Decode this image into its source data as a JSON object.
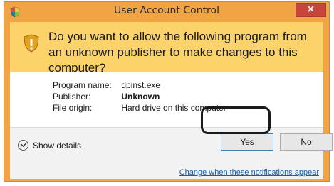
{
  "window": {
    "title": "User Account Control",
    "close_label": "×"
  },
  "prompt": {
    "question": "Do you want to allow the following program from an unknown publisher to make changes to this computer?"
  },
  "details": {
    "program_name_label": "Program name:",
    "program_name_value": "dpinst.exe",
    "publisher_label": "Publisher:",
    "publisher_value": "Unknown",
    "file_origin_label": "File origin:",
    "file_origin_value": "Hard drive on this computer"
  },
  "footer": {
    "show_details_label": "Show details",
    "yes_label": "Yes",
    "no_label": "No",
    "notification_link": "Change when these notifications appear"
  },
  "icons": {
    "title_icon": "uac-shield-icon",
    "warning_icon": "warning-shield-icon",
    "details_icon": "chevron-down-icon"
  },
  "colors": {
    "title_bar": "#f0a444",
    "header_background": "#fbd36a",
    "close_button": "#c7463a",
    "link": "#1e5ca8"
  }
}
